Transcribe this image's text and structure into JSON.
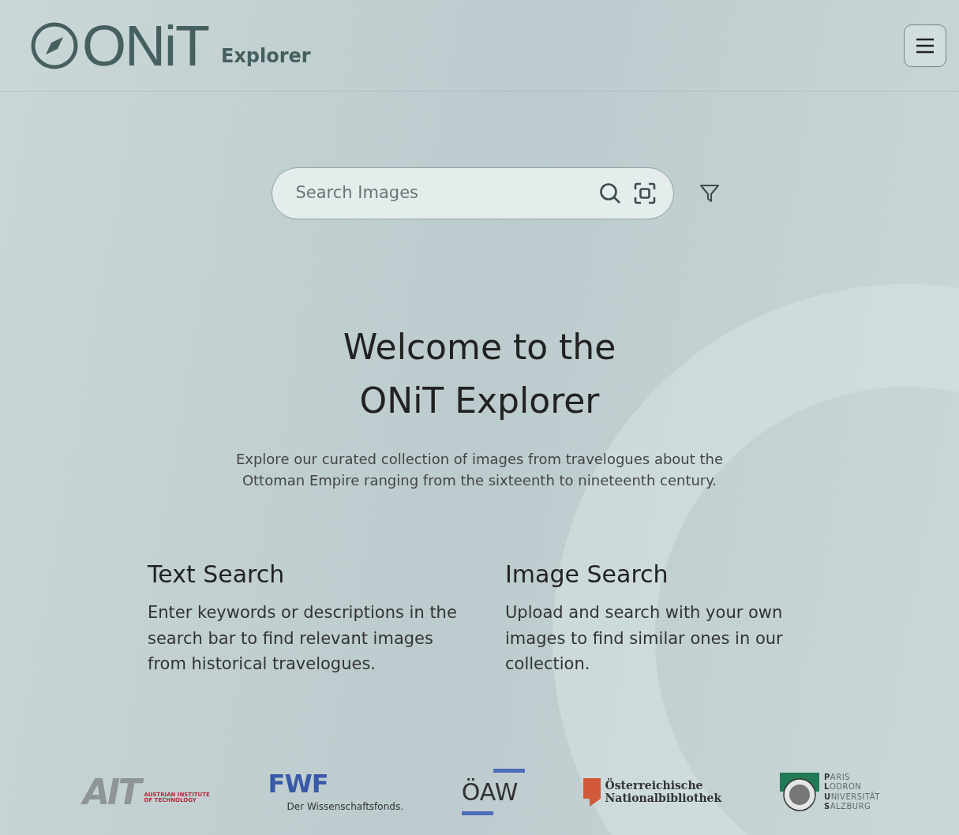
{
  "header": {
    "brand": "ONiT",
    "subtitle": "Explorer"
  },
  "search": {
    "placeholder": "Search Images"
  },
  "hero": {
    "title_lines": [
      "Welcome to the",
      "ONiT Explorer"
    ],
    "intro": "Explore our curated collection of images from travelogues about the Ottoman Empire ranging from the sixteenth to nineteenth century."
  },
  "features": [
    {
      "title": "Text Search",
      "text": "Enter keywords or descriptions in the search bar to find relevant images from historical travelogues."
    },
    {
      "title": "Image Search",
      "text": "Upload and search with your own images to find similar ones in our collection."
    }
  ],
  "partners": [
    {
      "kind": "ait",
      "lines": [
        "AIT",
        "AUSTRIAN INSTITUTE",
        "OF TECHNOLOGY"
      ]
    },
    {
      "kind": "fwf",
      "lines": [
        "FWF",
        "Der Wissenschaftsfonds."
      ]
    },
    {
      "kind": "oeaw",
      "lines": [
        "ÖAW"
      ]
    },
    {
      "kind": "onb",
      "lines": [
        "Österreichische",
        "Nationalbibliothek"
      ]
    },
    {
      "kind": "plus",
      "lines": [
        "**P**ARIS",
        "**L**ODRON",
        "**U**NIVERSITÄT",
        "**S**ALZBURG"
      ]
    }
  ]
}
